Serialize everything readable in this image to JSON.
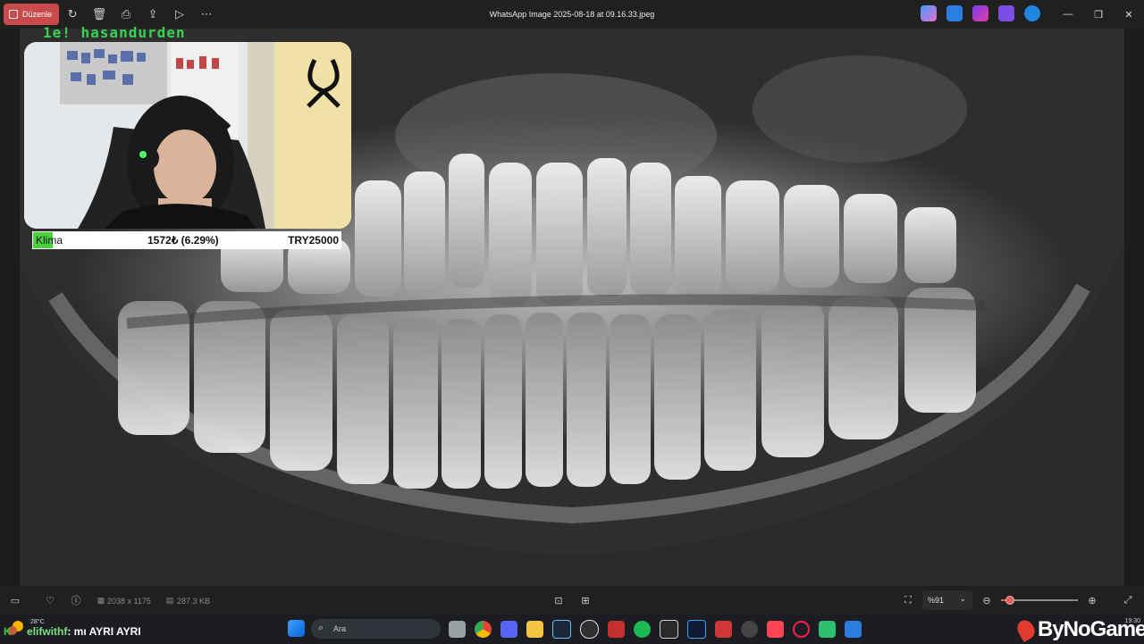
{
  "toolbar": {
    "edit_label": "Düzenle",
    "window_title": "WhatsApp Image 2025-08-18 at 09.16.33.jpeg"
  },
  "overlay": {
    "follower_text": "1e! hasandurden",
    "donation": {
      "item": "Klima",
      "current": "1572₺ (6.29%)",
      "goal": "TRY25000"
    }
  },
  "statusbar": {
    "dimensions": "2038 x 1175",
    "file_size": "287.3 KB",
    "zoom": "%91",
    "zoom_fraction": 0.12
  },
  "taskbar": {
    "temperature": "28°C",
    "search_placeholder": "Ara",
    "time": "19:30",
    "chat_prefix": "K",
    "chat_user": "elifwithf",
    "chat_message": ": mı AYRI AYRI",
    "brand": "ByNoGame"
  },
  "colors": {
    "accent_edit": "#c94a4a",
    "overlay_green": "#39d353",
    "slider_accent": "#e0605f"
  }
}
